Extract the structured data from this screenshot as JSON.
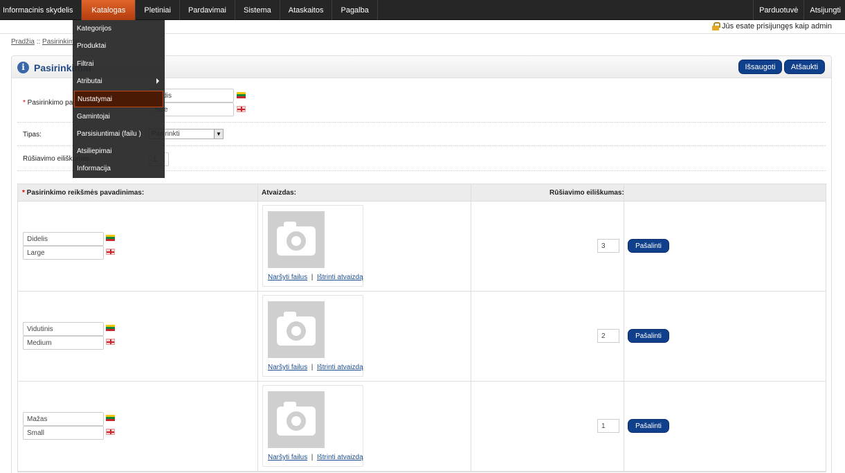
{
  "topnav": {
    "left": [
      "Informacinis skydelis",
      "Katalogas",
      "Pletiniai",
      "Pardavimai",
      "Sistema",
      "Ataskaitos",
      "Pagalba"
    ],
    "right": [
      "Parduotuvė",
      "Atsijungti"
    ]
  },
  "dropdown": {
    "items": [
      "Kategorijos",
      "Produktai",
      "Filtrai",
      "Atributai",
      "Nustatymai",
      "Gamintojai",
      "Parsisiuntimai (failu )",
      "Atsiliepimai",
      "Informacija"
    ]
  },
  "login_text": "Jūs esate prisijungęs kaip admin",
  "breadcrumb": [
    "Pradžia",
    "Pasirinkimai"
  ],
  "breadcrumb_sep": "::",
  "panel": {
    "title": "Pasirinkimai",
    "save_label": "Išsaugoti",
    "cancel_label": "Atšaukti"
  },
  "form": {
    "name_label": "Pasirinkimo pavadinimas:",
    "name_lt": "Dydis",
    "name_en": "Size",
    "type_label": "Tipas:",
    "type_value": "Pasirinkti",
    "sort_label": "Rūšiavimo eiliškumas:",
    "sort_value": "1"
  },
  "table": {
    "headers": [
      "Pasirinkimo reikšmės pavadinimas:",
      "Atvaizdas:",
      "Rūšiavimo eiliškumas:"
    ],
    "browse_label": "Naršyti failus",
    "delete_img_label": "Ištrinti atvaizdą",
    "remove_label": "Pašalinti",
    "rows": [
      {
        "lt": "Didelis",
        "en": "Large",
        "sort": "3"
      },
      {
        "lt": "Vidutinis",
        "en": "Medium",
        "sort": "2"
      },
      {
        "lt": "Mažas",
        "en": "Small",
        "sort": "1"
      }
    ]
  },
  "colors": {
    "nav_bg": "#262626",
    "nav_active": "#c8501a",
    "button_blue": "#10408c",
    "title_blue": "#224a86"
  }
}
